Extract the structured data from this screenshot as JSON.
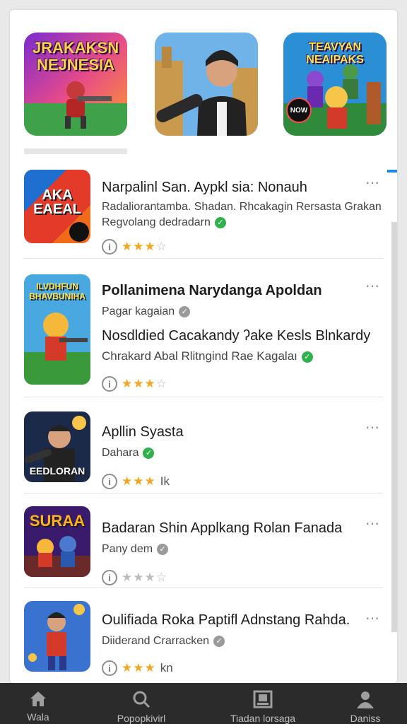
{
  "featured": [
    {
      "title": "JRAKAKSN\nNEJNESIA",
      "badge": ""
    },
    {
      "title": "",
      "badge": ""
    },
    {
      "title": "TEAVYAN\nNEAIPAKS",
      "badge": "NOW"
    }
  ],
  "apps": [
    {
      "title": "Narpalinl San. Aypkl sia: Nonauh",
      "subtitle": "Radaliorantamba. Shadan. Rhcakagin Rersasta Grakan",
      "subtitle2": "Regvolang dedradarn",
      "verified_color": "green",
      "stars": 3,
      "rating_text": "",
      "thumb_text": "AKA\nEAEAL"
    },
    {
      "title": "Pollanimena Narydanga Apoldan",
      "subtitle": "Pagar kagaian",
      "verified_color": "gray",
      "line": "Nosdldied Cacakandy ʔake Kesls Blnkardy",
      "line2": "Chrakard Abal Rlitngind Rae Kagalaı",
      "stars": 3,
      "rating_text": "",
      "thumb_text": "ILVDHFUN\nBHAVBUNIHA"
    },
    {
      "title": "Apllin Syasta",
      "subtitle": "Dahara",
      "verified_color": "green",
      "stars": 3,
      "rating_text": "Ik",
      "thumb_text": "EEDLORAN"
    },
    {
      "title": "Badaran Shin Applkang Rolan Fanada",
      "subtitle": "Pany dem",
      "verified_color": "gray",
      "stars": 0,
      "rating_text": "",
      "thumb_text": "SURAA"
    },
    {
      "title": "Oulifiada Roka Paptifl Adnstang Rahda.",
      "subtitle": "Diiderand Crarracken",
      "verified_color": "gray",
      "stars": 3,
      "rating_text": "kn",
      "thumb_text": ""
    }
  ],
  "icons": {
    "more": "⋯",
    "info": "i",
    "verified": "✓"
  },
  "nav": [
    {
      "label": "Wala",
      "icon": "home-icon"
    },
    {
      "label": "Popopkivirl",
      "icon": "search-icon"
    },
    {
      "label": "Tiadan lorsaga",
      "icon": "library-icon"
    },
    {
      "label": "Daniss",
      "icon": "profile-icon"
    }
  ],
  "colors": {
    "accent": "#1e88e5",
    "star": "#f5a623",
    "verified": "#2fb04a",
    "nav_bg": "#2b2b2b"
  }
}
